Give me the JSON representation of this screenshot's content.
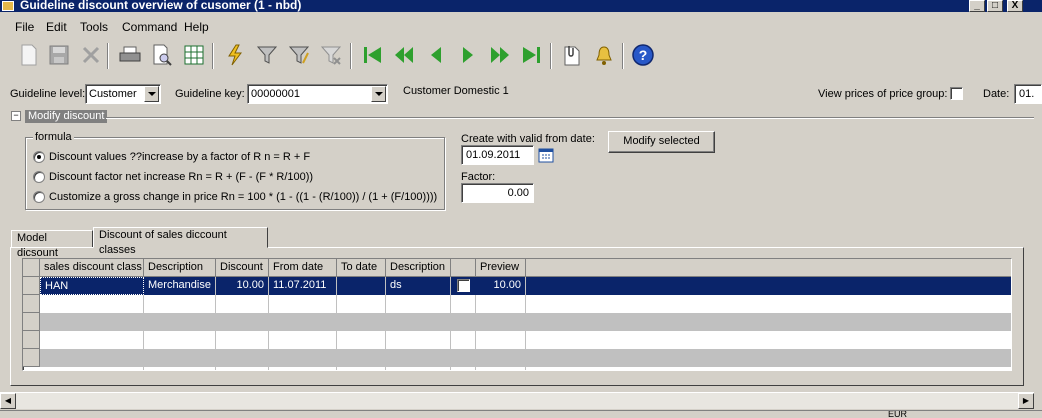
{
  "window": {
    "title": "Guideline discount overview of cusomer (1 - nbd)",
    "minimize": "_",
    "maximize": "□",
    "close": "X"
  },
  "menu": [
    "File",
    "Edit",
    "Tools",
    "Command",
    "Help"
  ],
  "toolbar": {
    "icons": [
      "new-icon",
      "save-icon",
      "delete-icon",
      "print-icon",
      "print-preview-icon",
      "excel-icon",
      "filter-by-selection-icon",
      "filter-icon",
      "advanced-filter-icon",
      "remove-filter-icon",
      "first-record-icon",
      "previous-page-icon",
      "previous-record-icon",
      "next-record-icon",
      "next-page-icon",
      "last-record-icon",
      "attachment-icon",
      "alert-icon",
      "help-icon"
    ]
  },
  "filters": {
    "guideline_level_label": "Guideline level:",
    "guideline_level_value": "Customer",
    "guideline_key_label": "Guideline key:",
    "guideline_key_value": "00000001",
    "customer_name": "Customer Domestic 1",
    "view_prices_label": "View prices of price group:",
    "date_label": "Date:",
    "date_value": "01."
  },
  "modify_section": {
    "toggle": "−",
    "title": "Modify discount",
    "formula_legend": "formula",
    "options": [
      {
        "label": "Discount values ??increase by a factor of R n = R + F",
        "selected": true
      },
      {
        "label": "Discount factor net increase Rn = R + (F - (F * R/100))",
        "selected": false
      },
      {
        "label": "Customize a gross change in price Rn = 100 * (1 - ((1 - (R/100)) / (1 + (F/100))))",
        "selected": false
      }
    ],
    "valid_from_label": "Create with valid from date:",
    "valid_from_value": "01.09.2011",
    "factor_label": "Factor:",
    "factor_value": "0.00",
    "modify_button": "Modify selected"
  },
  "tabs": [
    {
      "label": "Model dicsount",
      "active": false
    },
    {
      "label": "Discount of sales diccount classes",
      "active": true
    }
  ],
  "grid": {
    "columns": [
      "sales discount class",
      "Description",
      "Discount",
      "From date",
      "To date",
      "Description",
      "",
      "Preview"
    ],
    "rows": [
      {
        "class": "HAN",
        "description": "Merchandise",
        "discount": "10.00",
        "from_date": "11.07.2011",
        "to_date": "",
        "description2": "ds",
        "checked": false,
        "preview": "10.00",
        "selected": true
      }
    ]
  },
  "status": {
    "currency": "EUR"
  },
  "colors": {
    "selection": "#0a246a",
    "title_bar": "#0a246a",
    "window_bg": "#d4d0c8"
  }
}
